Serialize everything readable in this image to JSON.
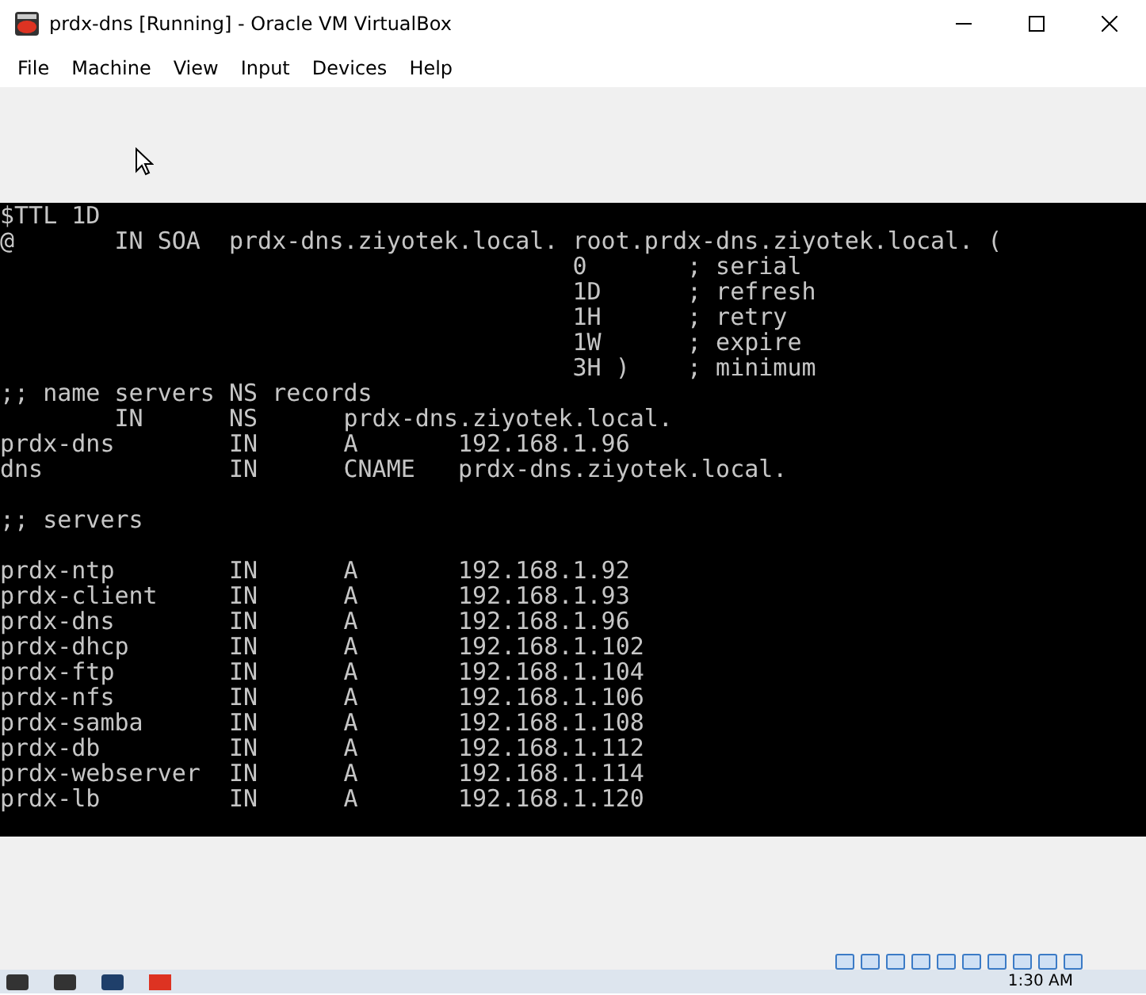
{
  "window": {
    "title": "prdx-dns [Running] - Oracle VM VirtualBox"
  },
  "menu": [
    "File",
    "Machine",
    "View",
    "Input",
    "Devices",
    "Help"
  ],
  "terminal": {
    "lines": [
      {
        "kind": "text",
        "text": "$TTL 1D"
      },
      {
        "kind": "text",
        "text": "@       IN SOA  prdx-dns.ziyotek.local. root.prdx-dns.ziyotek.local. ("
      },
      {
        "kind": "text",
        "text": "                                        0       ; serial"
      },
      {
        "kind": "text",
        "text": "                                        1D      ; refresh"
      },
      {
        "kind": "text",
        "text": "                                        1H      ; retry"
      },
      {
        "kind": "text",
        "text": "                                        1W      ; expire"
      },
      {
        "kind": "text",
        "text": "                                        3H )    ; minimum"
      },
      {
        "kind": "text",
        "text": ";; name servers NS records"
      },
      {
        "kind": "text",
        "text": "        IN      NS      prdx-dns.ziyotek.local."
      },
      {
        "kind": "text",
        "text": "prdx-dns        IN      A       192.168.1.96"
      },
      {
        "kind": "text",
        "text": "dns             IN      CNAME   prdx-dns.ziyotek.local."
      },
      {
        "kind": "blank"
      },
      {
        "kind": "text",
        "text": ";; servers"
      },
      {
        "kind": "blank"
      },
      {
        "kind": "text",
        "text": "prdx-ntp        IN      A       192.168.1.92"
      },
      {
        "kind": "text",
        "text": "prdx-client     IN      A       192.168.1.93"
      },
      {
        "kind": "text",
        "text": "prdx-dns        IN      A       192.168.1.96"
      },
      {
        "kind": "text",
        "text": "prdx-dhcp       IN      A       192.168.1.102"
      },
      {
        "kind": "text",
        "text": "prdx-ftp        IN      A       192.168.1.104"
      },
      {
        "kind": "text",
        "text": "prdx-nfs        IN      A       192.168.1.106"
      },
      {
        "kind": "text",
        "text": "prdx-samba      IN      A       192.168.1.108"
      },
      {
        "kind": "text",
        "text": "prdx-db         IN      A       192.168.1.112"
      },
      {
        "kind": "text",
        "text": "prdx-webserver  IN      A       192.168.1.114"
      },
      {
        "kind": "text",
        "text": "prdx-lb         IN      A       192.168.1.120"
      }
    ]
  },
  "taskbar": {
    "clock": "1:30 AM"
  }
}
